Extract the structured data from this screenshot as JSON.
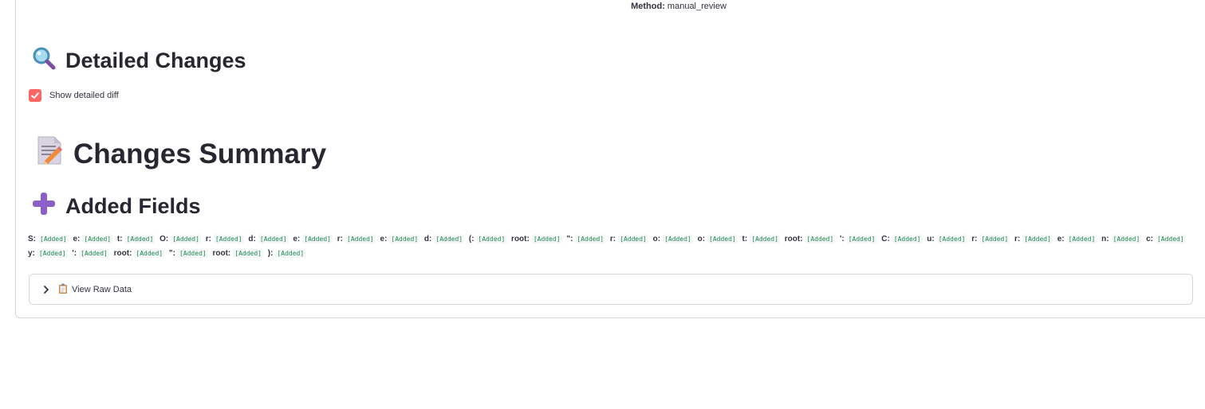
{
  "header": {
    "method_label": "Method:",
    "method_value": "manual_review"
  },
  "detailed_changes": {
    "title": "Detailed Changes",
    "icon": "magnifier-icon",
    "checkbox_label": "Show detailed diff",
    "checkbox_checked": true
  },
  "changes_summary": {
    "title": "Changes Summary",
    "icon": "memo-icon"
  },
  "added_fields": {
    "title": "Added Fields",
    "icon": "plus-icon",
    "tag": "[Added]",
    "items": [
      "S:",
      "e:",
      "t:",
      "O:",
      "r:",
      "d:",
      "e:",
      "r:",
      "e:",
      "d:",
      "(:",
      "root:",
      "\":",
      "r:",
      "o:",
      "o:",
      "t:",
      "root:",
      "':",
      "C:",
      "u:",
      "r:",
      "r:",
      "e:",
      "n:",
      "c:",
      "y:",
      "':",
      "root:",
      "\":",
      "root:",
      "):"
    ]
  },
  "expander": {
    "label": "View Raw Data",
    "icon": "clipboard-icon"
  },
  "colors": {
    "accent": "#ff4b4b",
    "added_tag": "#1c8c4e"
  }
}
